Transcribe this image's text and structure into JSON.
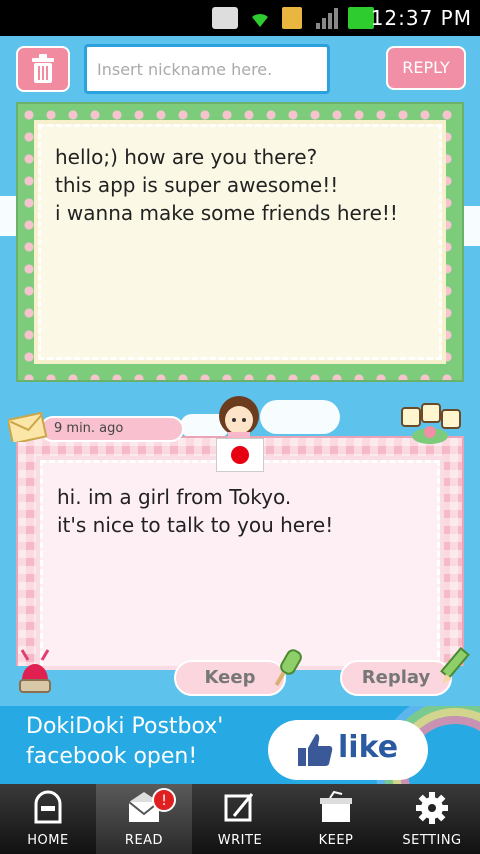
{
  "status_bar": {
    "time": "12:37 PM"
  },
  "top_bar": {
    "nickname_placeholder": "Insert nickname here.",
    "reply_label": "REPLY"
  },
  "messages": [
    {
      "text_lines": [
        "hello;) how are you there?",
        "this app is super awesome!!",
        "i wanna make some friends here!!"
      ]
    },
    {
      "time_ago": "9 min. ago",
      "text_lines": [
        "hi. im a girl from Tokyo.",
        "it's nice to talk to you here!"
      ]
    }
  ],
  "actions": {
    "keep_label": "Keep",
    "replay_label": "Replay"
  },
  "banner": {
    "line1": "DokiDoki Postbox'",
    "line2": "facebook open!",
    "like_text": "like"
  },
  "nav": {
    "items": [
      {
        "label": "HOME",
        "icon": "mailbox-icon"
      },
      {
        "label": "READ",
        "icon": "open-envelope-icon",
        "badge": "!"
      },
      {
        "label": "WRITE",
        "icon": "write-icon"
      },
      {
        "label": "KEEP",
        "icon": "keep-box-icon"
      },
      {
        "label": "SETTING",
        "icon": "gear-icon"
      }
    ]
  },
  "colors": {
    "sky": "#5ec3ec",
    "pink": "#f18fa6",
    "green": "#7ccc7c",
    "banner": "#27a9e3"
  }
}
